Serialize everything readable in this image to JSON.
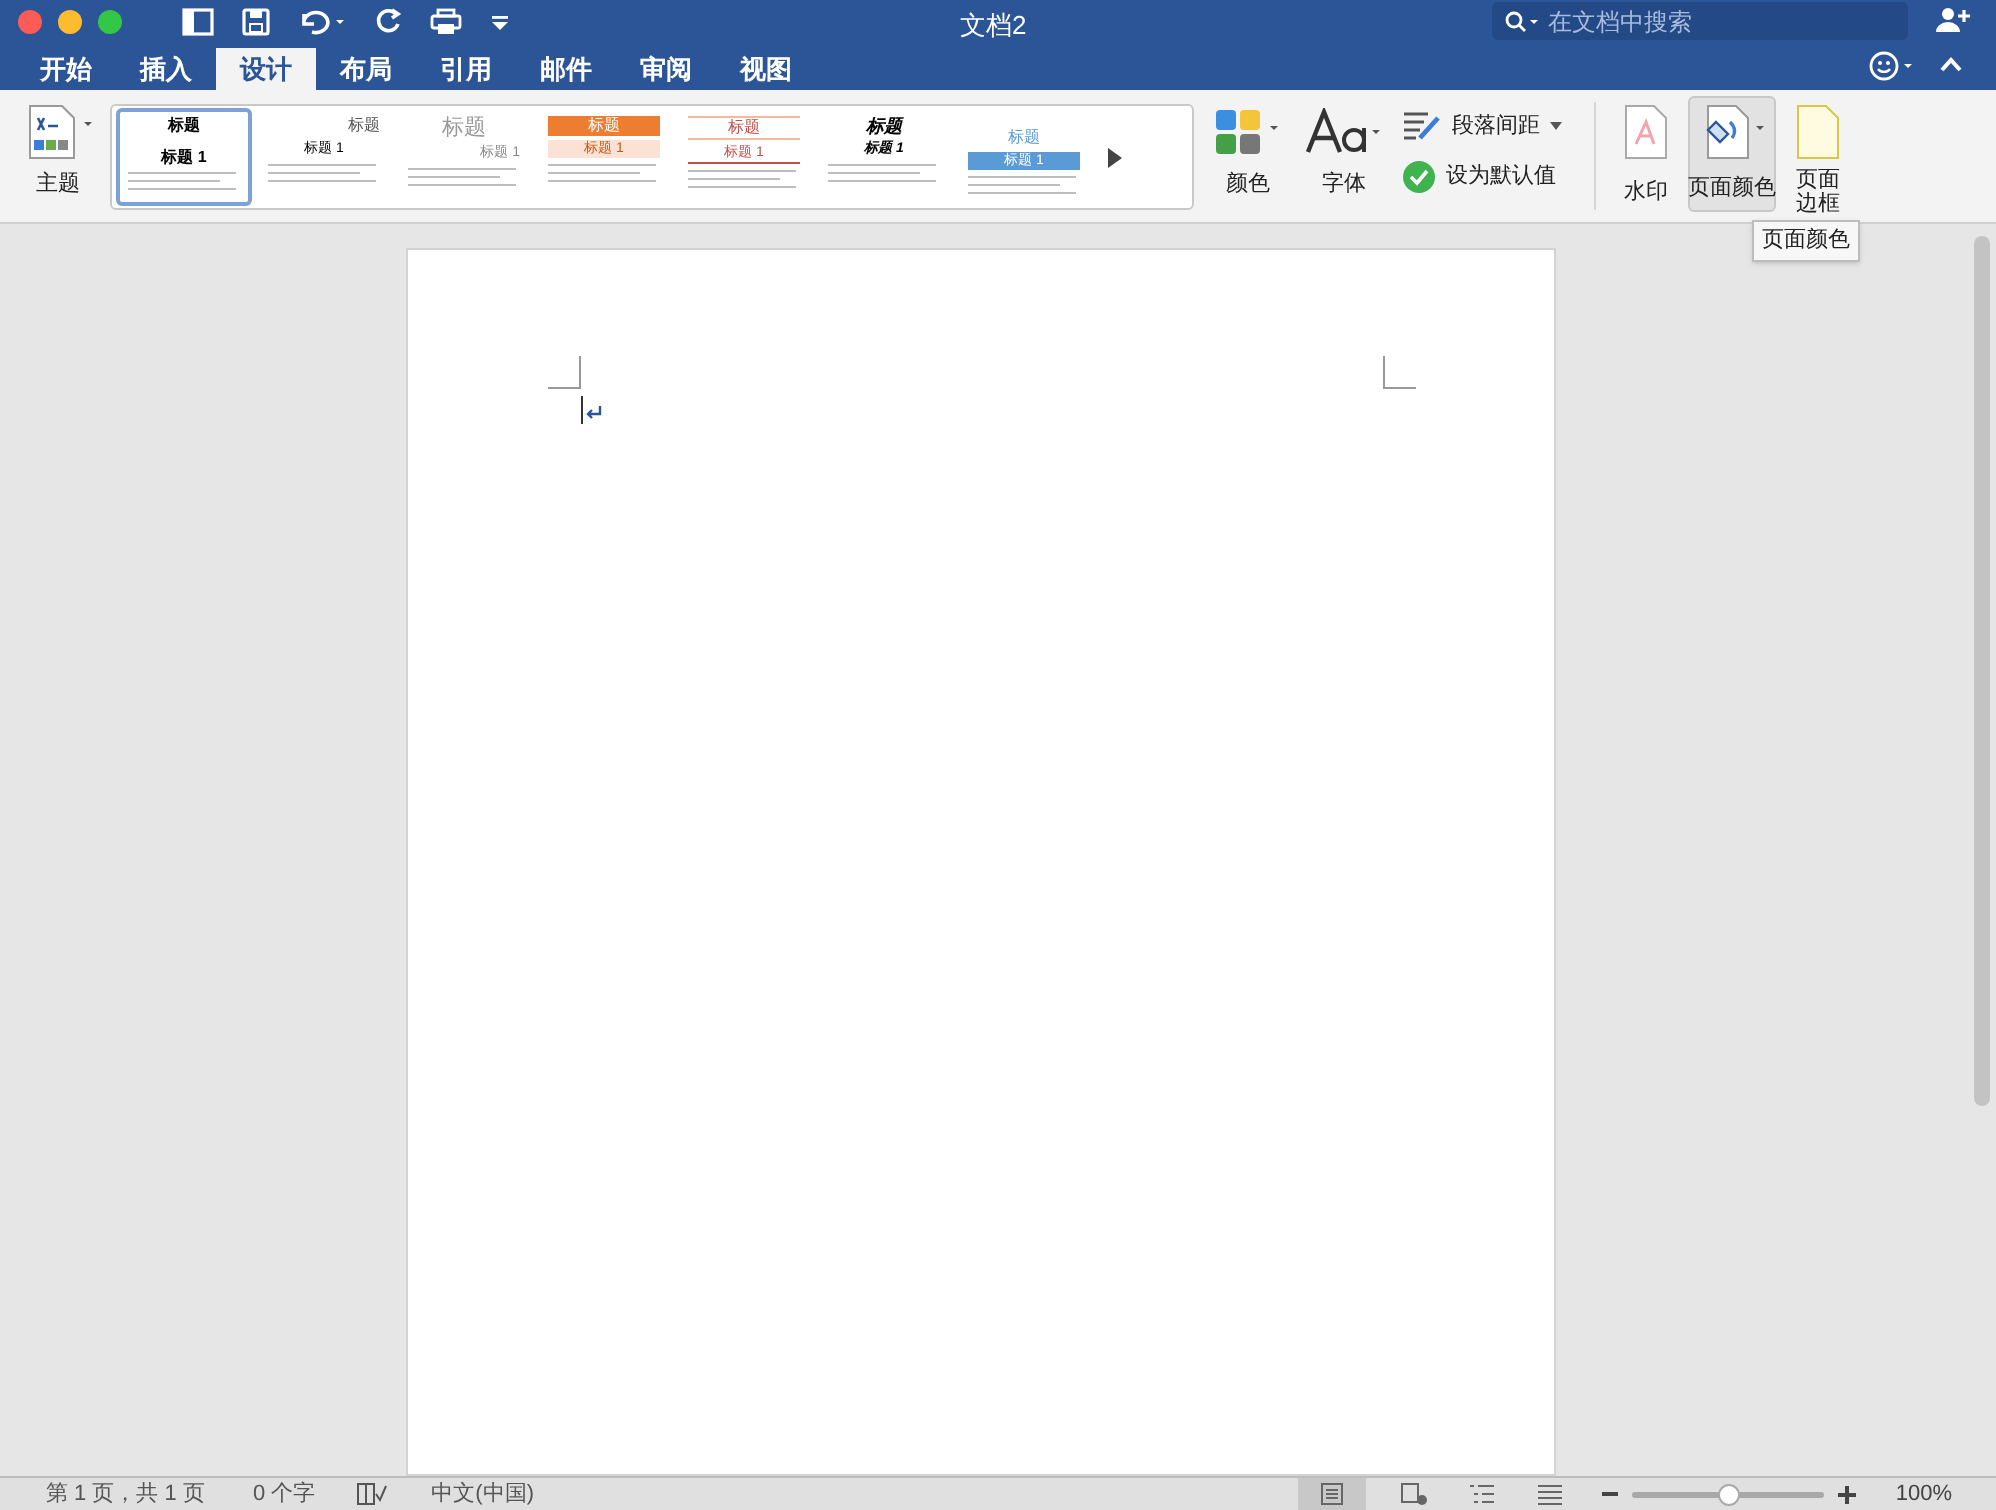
{
  "window": {
    "title": "文档2"
  },
  "search": {
    "placeholder": "在文档中搜索"
  },
  "tabs": [
    {
      "label": "开始",
      "selected": false
    },
    {
      "label": "插入",
      "selected": false
    },
    {
      "label": "设计",
      "selected": true
    },
    {
      "label": "布局",
      "selected": false
    },
    {
      "label": "引用",
      "selected": false
    },
    {
      "label": "邮件",
      "selected": false
    },
    {
      "label": "审阅",
      "selected": false
    },
    {
      "label": "视图",
      "selected": false
    }
  ],
  "ribbon": {
    "theme_label": "主题",
    "styles": [
      {
        "kind": "centered",
        "title": "标题",
        "heading": "标题 1",
        "selected": true
      },
      {
        "kind": "right",
        "title": "标题",
        "heading": "标题 1",
        "selected": false
      },
      {
        "kind": "light",
        "title": "标题",
        "heading": "标题 1",
        "selected": false
      },
      {
        "kind": "banner",
        "title": "标题",
        "heading": "标题 1",
        "selected": false
      },
      {
        "kind": "lined",
        "title": "标题",
        "heading": "标题 1",
        "selected": false
      },
      {
        "kind": "italic",
        "title": "标题",
        "heading": "标题 1",
        "selected": false
      },
      {
        "kind": "bar",
        "title": "标题",
        "heading": "标题 1",
        "selected": false
      }
    ],
    "colors_label": "颜色",
    "fonts_label": "字体",
    "spacing_label": "段落间距",
    "default_label": "设为默认值",
    "watermark_label": "水印",
    "page_color_label": "页面颜色",
    "page_border_label": "页面边框",
    "tooltip": "页面颜色"
  },
  "status_bar": {
    "page": "第 1 页，共 1 页",
    "words": "0 个字",
    "language": "中文(中国)",
    "zoom": "100%",
    "zoom_slider": {
      "level": 0.5
    }
  }
}
